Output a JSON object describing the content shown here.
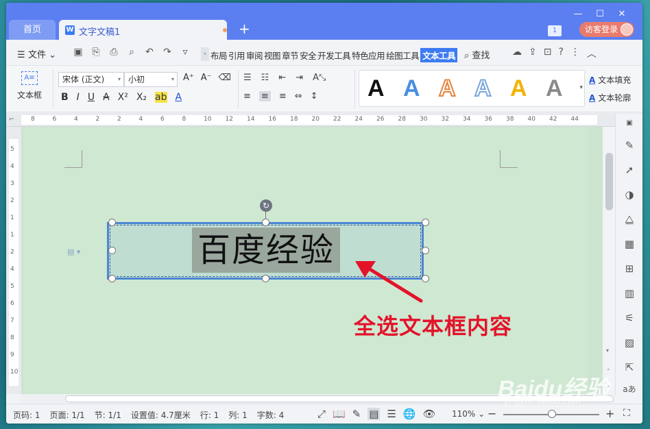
{
  "titlebar": {
    "home_tab": "首页",
    "doc_icon": "W",
    "doc_title": "文字文稿1",
    "new_tab": "+",
    "page_badge": "1",
    "visitor_login": "访客登录",
    "controls": [
      "—",
      "☐",
      "✕"
    ]
  },
  "menubar": {
    "file_label": "文件",
    "tabs": [
      "布局",
      "引用",
      "审阅",
      "视图",
      "章节",
      "安全",
      "开发工具",
      "特色应用",
      "绘图工具",
      "文本工具"
    ],
    "active_tab": "文本工具",
    "find_label": "查找"
  },
  "ribbon": {
    "textbox_label": "文本框",
    "font_name": "宋体 (正文)",
    "font_size": "小初",
    "style_letter": "A",
    "text_fill_label": "文本填充",
    "text_outline_label": "文本轮廓",
    "style_colors": [
      "#111111",
      "#4a8ee0",
      "#e3833a",
      "#7aa6dd",
      "#f2b300",
      "#8a8a8a"
    ]
  },
  "ruler": {
    "h_labels": [
      "8",
      "6",
      "4",
      "2",
      "2",
      "4",
      "6",
      "8",
      "10",
      "12",
      "14",
      "16",
      "18",
      "20",
      "22",
      "24",
      "26",
      "28",
      "30",
      "32",
      "34",
      "36",
      "38",
      "40",
      "42",
      "44"
    ],
    "v_labels": [
      "5",
      "4",
      "3",
      "2",
      "1",
      "1",
      "2",
      "4",
      "5",
      "6",
      "7",
      "8",
      "9",
      "10"
    ]
  },
  "document": {
    "textbox_content": "百度经验",
    "annotation": "全选文本框内容",
    "annotation_color": "#e3132a"
  },
  "statusbar": {
    "page_num": "页码: 1",
    "pages": "页面: 1/1",
    "section": "节: 1/1",
    "setting": "设置值: 4.7厘米",
    "row": "行: 1",
    "col": "列: 1",
    "chars": "字数: 4",
    "zoom": "110%"
  },
  "watermark": {
    "text": "Baidu经验",
    "sub": "jingyan.baidu.com"
  }
}
